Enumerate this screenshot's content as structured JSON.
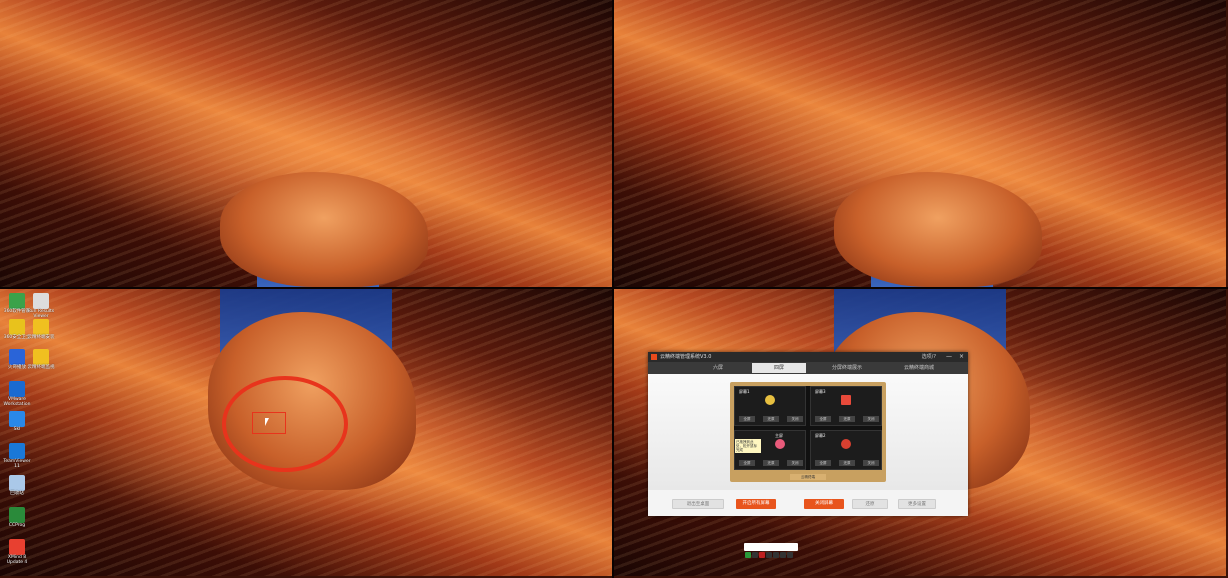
{
  "desktop_icons": [
    {
      "label": "360软件管家",
      "color": "#3aa24a"
    },
    {
      "label": "Run Results Viewer",
      "color": "#dddddd"
    },
    {
      "label": "360安全卫士",
      "color": "#e8c21c"
    },
    {
      "label": "云精终端安装",
      "color": "#f0c020"
    },
    {
      "label": "火哥播放",
      "color": "#2a64d8"
    },
    {
      "label": "云精终端监视",
      "color": "#f0c020"
    },
    {
      "label": "VMware Workstation",
      "color": "#1a6ad0"
    },
    {
      "label": "SkI",
      "color": "#2a88e8"
    },
    {
      "label": "TeamViewer 11",
      "color": "#1a78d8"
    },
    {
      "label": "回收站",
      "color": "#aac8e8"
    },
    {
      "label": "CCProg",
      "color": "#2a8a3a"
    },
    {
      "label": "XMind 8 Update 4",
      "color": "#e84030"
    }
  ],
  "app": {
    "title": "云精终端管理系统V3.0",
    "help": "选项/?",
    "minimize": "—",
    "close": "×",
    "tabs": [
      {
        "label": "六屏"
      },
      {
        "label": "四屏"
      },
      {
        "label": "分屏终端展示"
      },
      {
        "label": "云精终端商城"
      }
    ],
    "screens": [
      {
        "name": "屏幕1",
        "buttons": [
          "全屏",
          "还原",
          "关闭"
        ],
        "icon_color": "#e8c040"
      },
      {
        "name": "屏幕3",
        "buttons": [
          "全屏",
          "还原",
          "关闭"
        ],
        "icon_color": "#e84a3a"
      },
      {
        "name": "主屏",
        "buttons": [
          "全屏",
          "还原",
          "关闭"
        ],
        "icon_color": "#e85a7a"
      },
      {
        "name": "屏幕2",
        "buttons": [
          "全屏",
          "还原",
          "关闭"
        ],
        "icon_color": "#d84030"
      }
    ],
    "tooltip": "已拖拽到此处，松开鼠标完成",
    "stand_label": "云精终端",
    "footer": {
      "left_button": "退出至桌面",
      "main_button": "开启所有屏幕",
      "close_all": "关闭屏幕",
      "restore": "还原",
      "more": "更多设置"
    }
  },
  "tray_icons": [
    "#2a9a3a",
    "#333333",
    "#c02020",
    "#333333",
    "#333333",
    "#333333",
    "#333333"
  ]
}
